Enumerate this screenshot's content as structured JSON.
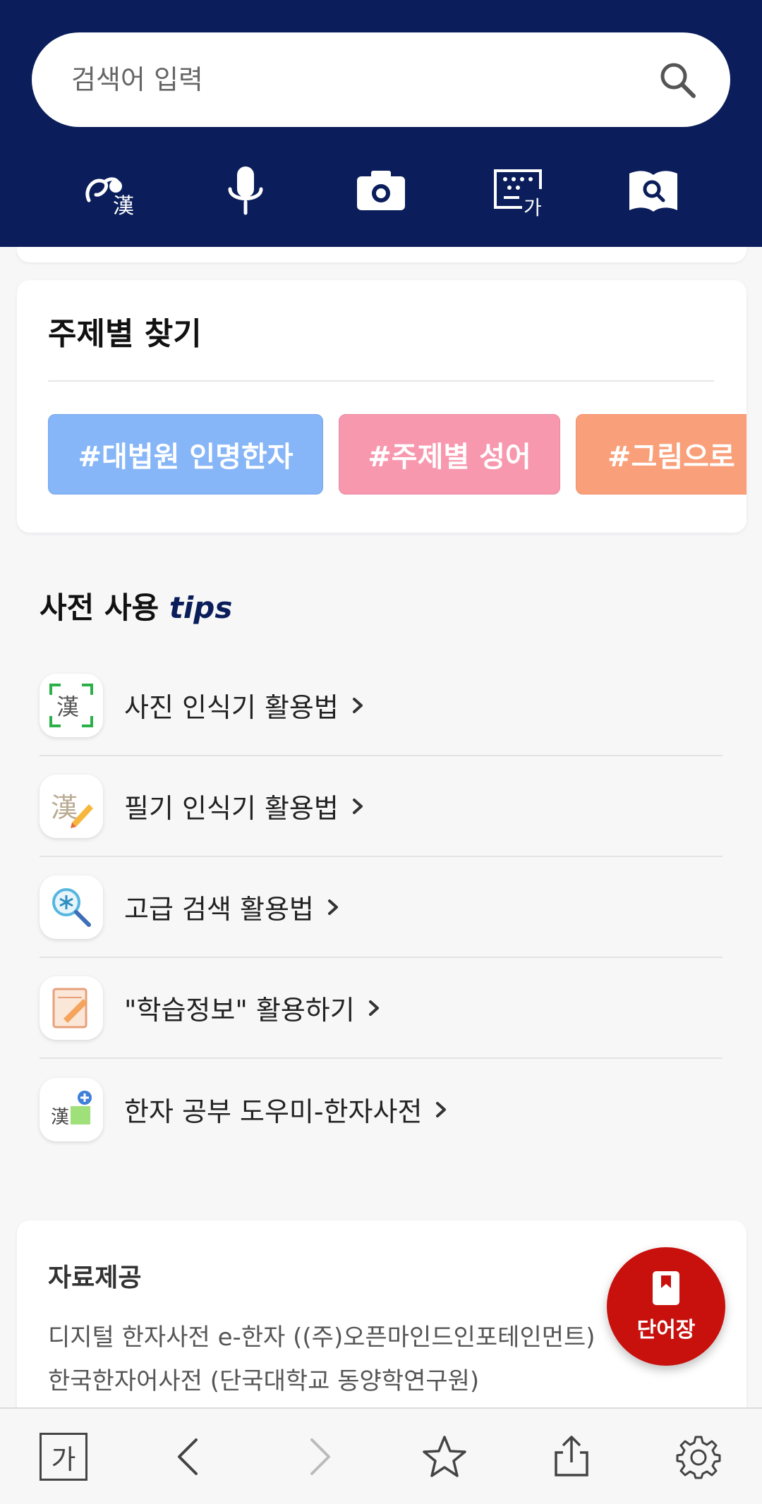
{
  "header": {
    "search": {
      "placeholder": "검색어 입력"
    },
    "tools": [
      {
        "icon": "handwriting-hanja-icon"
      },
      {
        "icon": "microphone-icon"
      },
      {
        "icon": "camera-icon"
      },
      {
        "icon": "keyboard-hangul-icon"
      },
      {
        "icon": "book-search-icon"
      }
    ],
    "hanja_glyph": "漢",
    "keyboard_glyph": "가"
  },
  "topic": {
    "title": "주제별 찾기",
    "chips": [
      {
        "label": "#대법원 인명한자",
        "color": "#86b6f7"
      },
      {
        "label": "#주제별 성어",
        "color": "#f798ae"
      },
      {
        "label": "#그림으로 배",
        "color": "#f9a07a"
      }
    ]
  },
  "tips": {
    "title": "사전 사용",
    "title_accent": "tips",
    "items": [
      {
        "label": "사진 인식기 활용법",
        "icon": "photo-recognition-icon"
      },
      {
        "label": "필기 인식기 활용법",
        "icon": "handwriting-recognition-icon"
      },
      {
        "label": "고급 검색 활용법",
        "icon": "advanced-search-icon"
      },
      {
        "label": "\"학습정보\" 활용하기",
        "icon": "study-info-icon"
      },
      {
        "label": "한자 공부 도우미-한자사전",
        "icon": "hanja-helper-icon"
      }
    ]
  },
  "source": {
    "title": "자료제공",
    "lines": [
      "디지털 한자사전 e-한자 ((주)오픈마인드인포테인먼트)",
      "한국한자어사전 (단국대학교 동양학연구원)"
    ]
  },
  "fab": {
    "label": "단어장",
    "icon": "bookmark-icon"
  },
  "bottom_bar": {
    "font_label": "가",
    "items": [
      "font-size-button",
      "back-arrow-icon",
      "forward-arrow-icon",
      "star-icon",
      "share-icon",
      "gear-icon"
    ]
  },
  "colors": {
    "header_bg": "#0b1e5b",
    "fab_bg": "#c8100d"
  }
}
